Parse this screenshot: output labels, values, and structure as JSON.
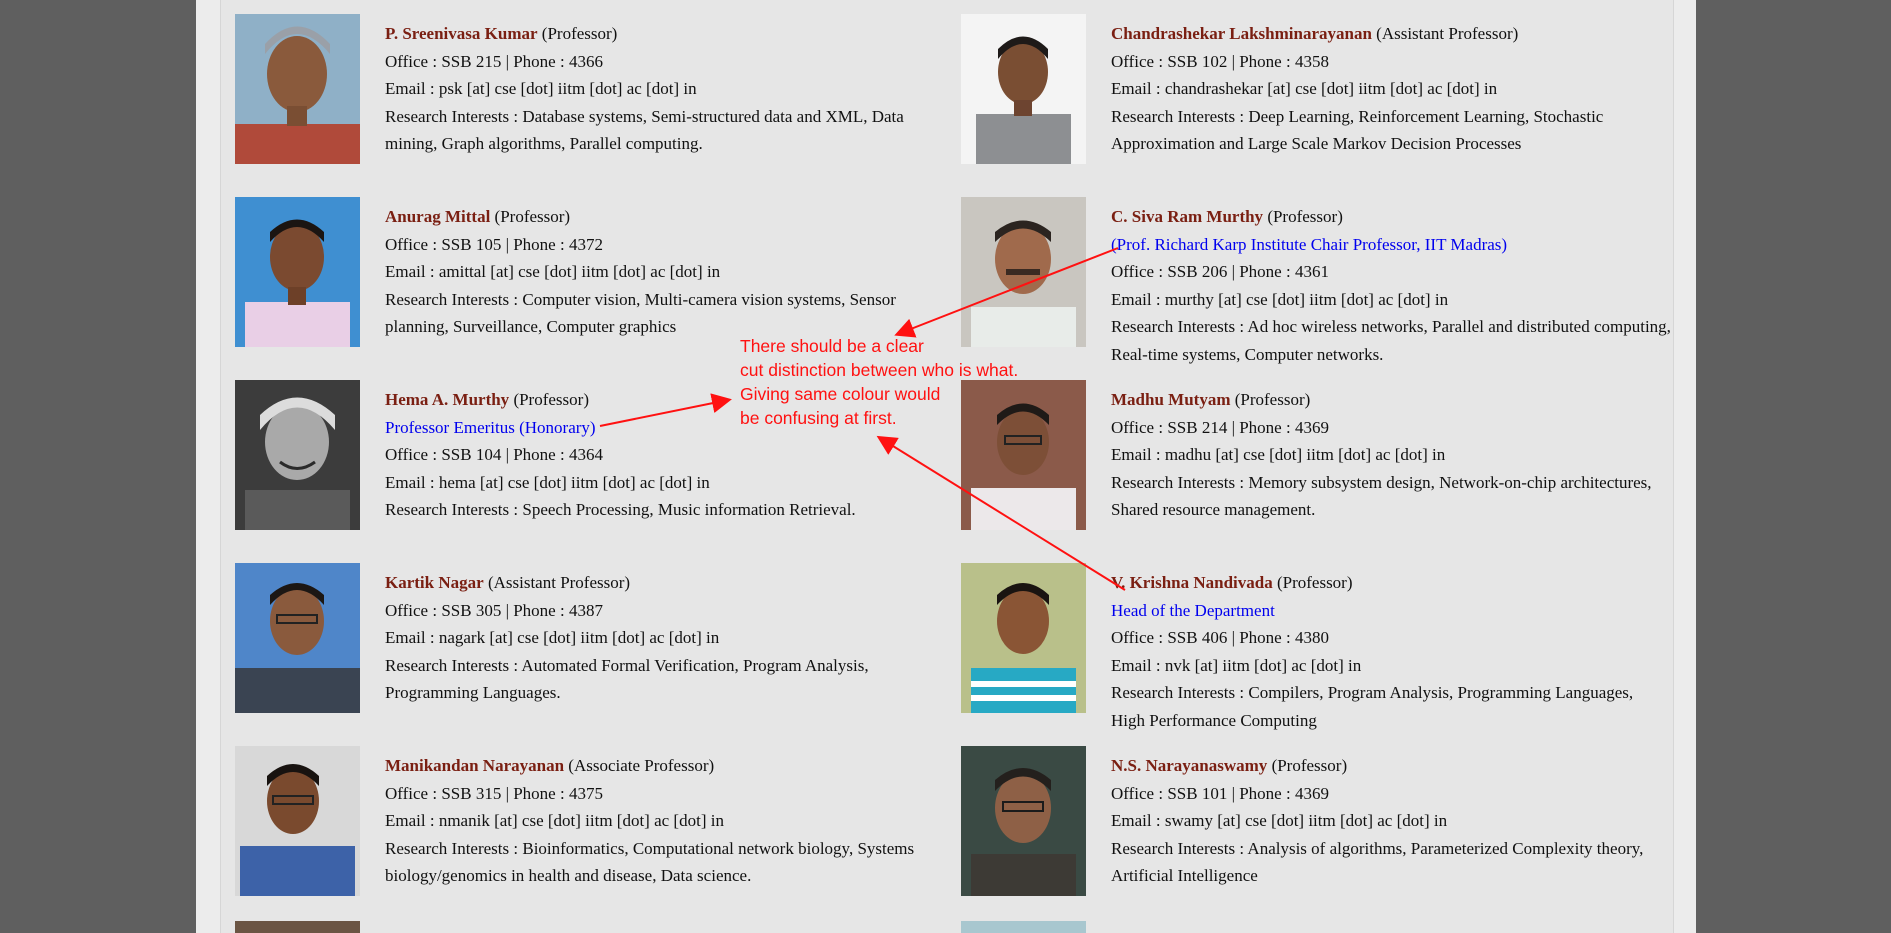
{
  "colors": {
    "name": "#7a1f12",
    "designation": "#0000ee",
    "annotation": "#ff1111",
    "background": "#e6e6e6",
    "outer": "#5f5f5f"
  },
  "faculty": [
    {
      "name": "P. Sreenivasa Kumar",
      "role": "(Professor)",
      "designation": "",
      "office": "Office : SSB 215 | Phone : 4366",
      "email": "Email : psk [at] cse [dot] iitm [dot] ac [dot] in",
      "research": "Research Interests : Database systems, Semi-structured data and XML, Data mining, Graph algorithms, Parallel computing."
    },
    {
      "name": "Chandrashekar Lakshminarayanan",
      "role": "(Assistant Professor)",
      "designation": "",
      "office": "Office : SSB 102 | Phone : 4358",
      "email": "Email : chandrashekar [at] cse [dot] iitm [dot] ac [dot] in",
      "research": "Research Interests : Deep Learning, Reinforcement Learning, Stochastic Approximation and Large Scale Markov Decision Processes"
    },
    {
      "name": "Anurag Mittal",
      "role": "(Professor)",
      "designation": "",
      "office": "Office : SSB 105 | Phone : 4372",
      "email": "Email : amittal [at] cse [dot] iitm [dot] ac [dot] in",
      "research": "Research Interests : Computer vision, Multi-camera vision systems, Sensor planning, Surveillance, Computer graphics"
    },
    {
      "name": "C. Siva Ram Murthy",
      "role": "(Professor)",
      "designation": "(Prof. Richard Karp Institute Chair Professor, IIT Madras)",
      "office": "Office : SSB 206 | Phone : 4361",
      "email": "Email : murthy [at] cse [dot] iitm [dot] ac [dot] in",
      "research": "Research Interests : Ad hoc wireless networks, Parallel and distributed computing, Real-time systems, Computer networks."
    },
    {
      "name": "Hema A. Murthy",
      "role": "(Professor)",
      "designation": "Professor Emeritus (Honorary)",
      "office": "Office : SSB 104 | Phone : 4364",
      "email": "Email : hema [at] cse [dot] iitm [dot] ac [dot] in",
      "research": "Research Interests : Speech Processing, Music information Retrieval."
    },
    {
      "name": "Madhu Mutyam",
      "role": "(Professor)",
      "designation": "",
      "office": "Office : SSB 214 | Phone : 4369",
      "email": "Email : madhu [at] cse [dot] iitm [dot] ac [dot] in",
      "research": "Research Interests : Memory subsystem design, Network-on-chip architectures, Shared resource management."
    },
    {
      "name": "Kartik Nagar",
      "role": "(Assistant Professor)",
      "designation": "",
      "office": "Office : SSB 305 | Phone : 4387",
      "email": "Email : nagark [at] cse [dot] iitm [dot] ac [dot] in",
      "research": "Research Interests : Automated Formal Verification, Program Analysis, Programming Languages."
    },
    {
      "name": "V. Krishna Nandivada",
      "role": "(Professor)",
      "designation": "Head of the Department",
      "office": "Office : SSB 406 | Phone : 4380",
      "email": "Email : nvk [at] iitm [dot] ac [dot] in",
      "research": "Research Interests : Compilers, Program Analysis, Programming Languages, High Performance Computing"
    },
    {
      "name": "Manikandan Narayanan",
      "role": "(Associate Professor)",
      "designation": "",
      "office": "Office : SSB 315 | Phone : 4375",
      "email": "Email : nmanik [at] cse [dot] iitm [dot] ac [dot] in",
      "research": "Research Interests : Bioinformatics, Computational network biology, Systems biology/genomics in health and disease, Data science."
    },
    {
      "name": "N.S. Narayanaswamy",
      "role": "(Professor)",
      "designation": "",
      "office": "Office : SSB 101 | Phone : 4369",
      "email": "Email : swamy [at] cse [dot] iitm [dot] ac [dot] in",
      "research": "Research Interests : Analysis of algorithms, Parameterized Complexity theory, Artificial Intelligence"
    }
  ],
  "annotation": {
    "lines": [
      "There should be a clear",
      "cut distinction between who is what.",
      "Giving same colour would",
      "be confusing at first."
    ]
  }
}
